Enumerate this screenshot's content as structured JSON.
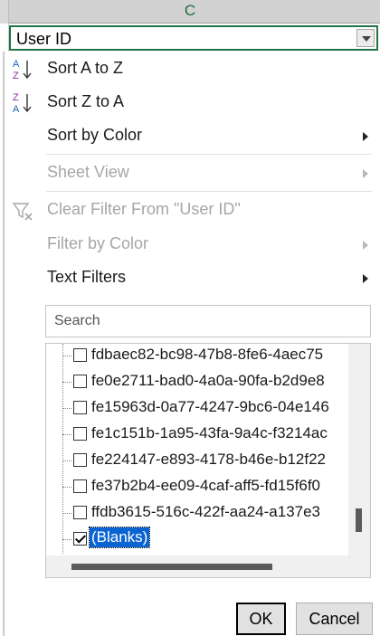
{
  "column_header": {
    "letter": "C"
  },
  "cell": {
    "value": "User ID",
    "filter_button_icon": "chevron-down-icon"
  },
  "menu": {
    "items": [
      {
        "label": "Sort A to Z",
        "icon": "sort-ascending-icon",
        "disabled": false,
        "has_submenu": false
      },
      {
        "label": "Sort Z to A",
        "icon": "sort-descending-icon",
        "disabled": false,
        "has_submenu": false
      },
      {
        "label": "Sort by Color",
        "disabled": false,
        "has_submenu": true
      },
      {
        "label": "Sheet View",
        "disabled": true,
        "has_submenu": true
      },
      {
        "label": "Clear Filter From \"User ID\"",
        "icon": "clear-filter-icon",
        "disabled": true,
        "has_submenu": false
      },
      {
        "label": "Filter by Color",
        "disabled": true,
        "has_submenu": true
      },
      {
        "label": "Text Filters",
        "disabled": false,
        "has_submenu": true
      }
    ]
  },
  "search": {
    "placeholder": "Search",
    "value": ""
  },
  "list": {
    "rows": [
      {
        "label": "fdbaec82-bc98-47b8-8fe6-4aec75",
        "checked": false,
        "selected": false
      },
      {
        "label": "fe0e2711-bad0-4a0a-90fa-b2d9e8",
        "checked": false,
        "selected": false
      },
      {
        "label": "fe15963d-0a77-4247-9bc6-04e146",
        "checked": false,
        "selected": false
      },
      {
        "label": "fe1c151b-1a95-43fa-9a4c-f3214ac",
        "checked": false,
        "selected": false
      },
      {
        "label": "fe224147-e893-4178-b46e-b12f22",
        "checked": false,
        "selected": false
      },
      {
        "label": "fe37b2b4-ee09-4caf-aff5-fd15f6f0",
        "checked": false,
        "selected": false
      },
      {
        "label": "ffdb3615-516c-422f-aa24-a137e3",
        "checked": false,
        "selected": false
      },
      {
        "label": "(Blanks)",
        "checked": true,
        "selected": true
      }
    ]
  },
  "buttons": {
    "ok": "OK",
    "cancel": "Cancel"
  },
  "colors": {
    "header_green": "#1e6e3a",
    "cell_border": "#217346",
    "selection": "#0a64d2"
  }
}
